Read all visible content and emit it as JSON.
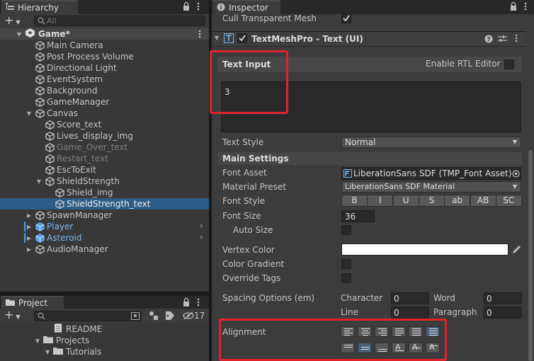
{
  "hierarchy": {
    "tab_label": "Hierarchy",
    "search_placeholder": "All",
    "scene": "Game*",
    "items": [
      {
        "label": "Main Camera",
        "state": "normal"
      },
      {
        "label": "Post Process Volume",
        "state": "normal"
      },
      {
        "label": "Directional Light",
        "state": "normal"
      },
      {
        "label": "EventSystem",
        "state": "normal"
      },
      {
        "label": "Background",
        "state": "normal"
      },
      {
        "label": "GameManager",
        "state": "normal"
      },
      {
        "label": "Canvas",
        "state": "normal"
      },
      {
        "label": "Score_text",
        "state": "normal"
      },
      {
        "label": "Lives_display_img",
        "state": "normal"
      },
      {
        "label": "Game_Over_text",
        "state": "disabled"
      },
      {
        "label": "Restart_text",
        "state": "disabled"
      },
      {
        "label": "EscToExit",
        "state": "normal"
      },
      {
        "label": "ShieldStrength",
        "state": "normal"
      },
      {
        "label": "Shield_img",
        "state": "normal"
      },
      {
        "label": "ShieldStrength_text",
        "state": "selected"
      },
      {
        "label": "SpawnManager",
        "state": "normal"
      },
      {
        "label": "Player",
        "state": "prefab"
      },
      {
        "label": "Asteroid",
        "state": "prefab"
      },
      {
        "label": "AudioManager",
        "state": "normal"
      }
    ]
  },
  "project": {
    "tab_label": "Project",
    "hidden_count": "17",
    "items": [
      {
        "label": "README"
      },
      {
        "label": "Projects"
      },
      {
        "label": "Tutorials"
      }
    ]
  },
  "inspector": {
    "tab_label": "Inspector",
    "cull_label": "Cull Transparent Mesh",
    "component_title": "TextMeshPro - Text (UI)",
    "text_input_header": "Text Input",
    "rtl_label": "Enable RTL Editor",
    "text_value": "3",
    "text_style_label": "Text Style",
    "text_style_value": "Normal",
    "main_settings": "Main Settings",
    "font_asset_label": "Font Asset",
    "font_asset_value": "LiberationSans SDF (TMP_Font Asset)",
    "material_label": "Material Preset",
    "material_value": "LiberationSans SDF Material",
    "font_style_label": "Font Style",
    "font_style_buttons": [
      "B",
      "I",
      "U",
      "S",
      "ab",
      "AB",
      "SC"
    ],
    "font_size_label": "Font Size",
    "font_size_value": "36",
    "auto_size_label": "Auto Size",
    "vertex_color_label": "Vertex Color",
    "vertex_color": "#ffffff",
    "color_gradient_label": "Color Gradient",
    "override_tags_label": "Override Tags",
    "spacing_label": "Spacing Options (em)",
    "character_label": "Character",
    "character_value": "0",
    "word_label": "Word",
    "word_value": "0",
    "line_label": "Line",
    "line_value": "0",
    "paragraph_label": "Paragraph",
    "paragraph_value": "0",
    "alignment_label": "Alignment"
  },
  "colors": {
    "selection": "#2c5d87",
    "highlight": "#e0242e",
    "prefab": "#7fb6ef"
  }
}
